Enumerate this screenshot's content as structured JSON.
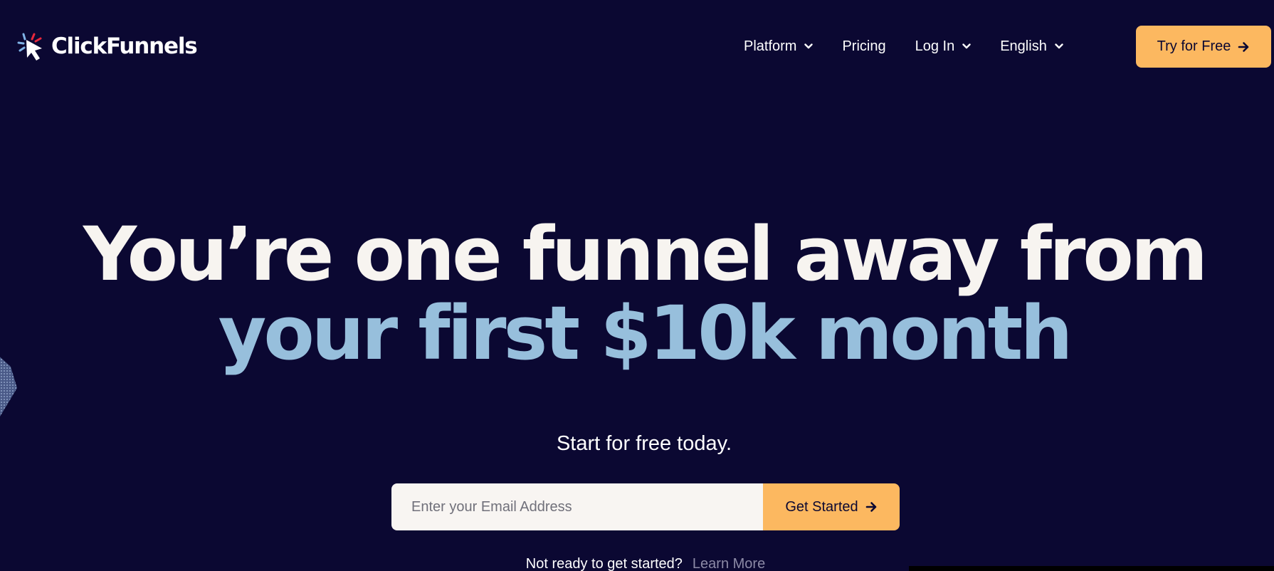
{
  "brand": {
    "name": "ClickFunnels",
    "logo_icon": "cursor-logo-icon"
  },
  "nav": {
    "items": [
      {
        "label": "Platform",
        "has_dropdown": true
      },
      {
        "label": "Pricing",
        "has_dropdown": false
      },
      {
        "label": "Log In",
        "has_dropdown": true
      },
      {
        "label": "English",
        "has_dropdown": true
      }
    ],
    "cta_label": "Try for Free"
  },
  "hero": {
    "headline_line1": "You’re one funnel away from",
    "headline_line2": "your first $10k month",
    "subheading": "Start for free today.",
    "email_placeholder": "Enter your Email Address",
    "submit_label": "Get Started",
    "not_ready_text": "Not ready to get started?",
    "learn_more_label": "Learn More"
  },
  "colors": {
    "background": "#0b0832",
    "accent": "#fcb860",
    "headline_primary": "#f7f4f0",
    "headline_highlight": "#97bfdc"
  }
}
